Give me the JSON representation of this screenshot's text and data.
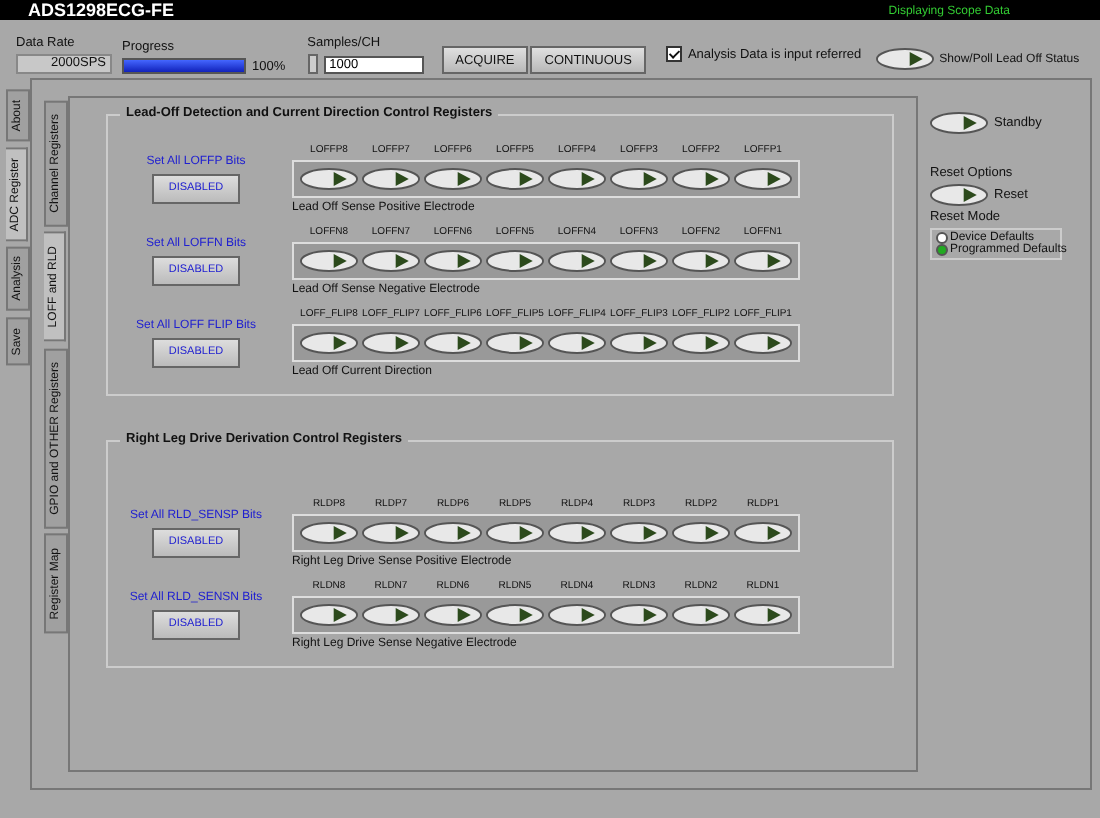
{
  "window": {
    "title": "ADS1298ECG-FE",
    "status": "Displaying Scope Data"
  },
  "toolbar": {
    "data_rate": {
      "label": "Data Rate",
      "value": "2000SPS"
    },
    "progress": {
      "label": "Progress",
      "level": 1,
      "reading": "100%"
    },
    "samples": {
      "label": "Samples/CH",
      "value": "1000"
    },
    "buttons": [
      "ACQUIRE",
      "CONTINUOUS"
    ],
    "input_referred": {
      "label": "Analysis Data is input referred",
      "checked": true
    },
    "show_poll": {
      "label": "Show/Poll Lead Off Status",
      "on": false
    }
  },
  "outer_tabs": [
    {
      "label": "About",
      "selected": false
    },
    {
      "label": "ADC Register",
      "selected": true
    },
    {
      "label": "Analysis",
      "selected": false
    },
    {
      "label": "Save",
      "selected": false
    }
  ],
  "inner_tabs": [
    {
      "label": "Channel Registers",
      "selected": false
    },
    {
      "label": "LOFF and RLD",
      "selected": true
    },
    {
      "label": "GPIO and OTHER Registers",
      "selected": false
    },
    {
      "label": "Register Map",
      "selected": false
    }
  ],
  "sections": [
    {
      "title": "Lead-Off Detection and Current Direction Control Registers",
      "groups": [
        {
          "set_label": "Set All LOFFP Bits",
          "button": "DISABLED",
          "caption": "Lead Off Sense Positive Electrode",
          "switches": [
            {
              "label": "LOFFP8",
              "on": false
            },
            {
              "label": "LOFFP7",
              "on": false
            },
            {
              "label": "LOFFP6",
              "on": false
            },
            {
              "label": "LOFFP5",
              "on": false
            },
            {
              "label": "LOFFP4",
              "on": false
            },
            {
              "label": "LOFFP3",
              "on": false
            },
            {
              "label": "LOFFP2",
              "on": false
            },
            {
              "label": "LOFFP1",
              "on": false
            }
          ]
        },
        {
          "set_label": "Set All LOFFN Bits",
          "button": "DISABLED",
          "caption": "Lead Off Sense Negative Electrode",
          "switches": [
            {
              "label": "LOFFN8",
              "on": false
            },
            {
              "label": "LOFFN7",
              "on": false
            },
            {
              "label": "LOFFN6",
              "on": false
            },
            {
              "label": "LOFFN5",
              "on": false
            },
            {
              "label": "LOFFN4",
              "on": false
            },
            {
              "label": "LOFFN3",
              "on": false
            },
            {
              "label": "LOFFN2",
              "on": false
            },
            {
              "label": "LOFFN1",
              "on": false
            }
          ]
        },
        {
          "set_label": "Set All LOFF FLIP Bits",
          "button": "DISABLED",
          "caption": "Lead Off Current Direction",
          "switches": [
            {
              "label": "LOFF_FLIP8",
              "on": false
            },
            {
              "label": "LOFF_FLIP7",
              "on": false
            },
            {
              "label": "LOFF_FLIP6",
              "on": false
            },
            {
              "label": "LOFF_FLIP5",
              "on": false
            },
            {
              "label": "LOFF_FLIP4",
              "on": false
            },
            {
              "label": "LOFF_FLIP3",
              "on": false
            },
            {
              "label": "LOFF_FLIP2",
              "on": false
            },
            {
              "label": "LOFF_FLIP1",
              "on": false
            }
          ]
        }
      ]
    },
    {
      "title": "Right Leg Drive Derivation Control Registers",
      "groups": [
        {
          "set_label": "Set All RLD_SENSP Bits",
          "button": "DISABLED",
          "caption": "Right Leg Drive Sense Positive Electrode",
          "switches": [
            {
              "label": "RLDP8",
              "on": false
            },
            {
              "label": "RLDP7",
              "on": false
            },
            {
              "label": "RLDP6",
              "on": false
            },
            {
              "label": "RLDP5",
              "on": false
            },
            {
              "label": "RLDP4",
              "on": false
            },
            {
              "label": "RLDP3",
              "on": false
            },
            {
              "label": "RLDP2",
              "on": false
            },
            {
              "label": "RLDP1",
              "on": false
            }
          ]
        },
        {
          "set_label": "Set All RLD_SENSN Bits",
          "button": "DISABLED",
          "caption": "Right Leg Drive Sense Negative Electrode",
          "switches": [
            {
              "label": "RLDN8",
              "on": false
            },
            {
              "label": "RLDN7",
              "on": false
            },
            {
              "label": "RLDN6",
              "on": false
            },
            {
              "label": "RLDN5",
              "on": false
            },
            {
              "label": "RLDN4",
              "on": false
            },
            {
              "label": "RLDN3",
              "on": false
            },
            {
              "label": "RLDN2",
              "on": false
            },
            {
              "label": "RLDN1",
              "on": false
            }
          ]
        }
      ]
    }
  ],
  "side": {
    "standby": {
      "label": "Standby",
      "on": false
    },
    "reset_options_label": "Reset Options",
    "reset": {
      "label": "Reset",
      "on": false
    },
    "reset_mode_label": "Reset Mode",
    "modes": [
      {
        "label": "Device Defaults",
        "selected": false
      },
      {
        "label": "Programmed Defaults",
        "selected": true
      }
    ]
  }
}
